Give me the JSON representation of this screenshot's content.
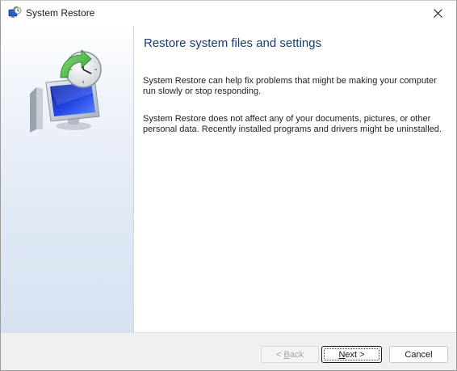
{
  "window": {
    "title": "System Restore",
    "app_icon": "system-restore-icon",
    "close_icon": "close-icon"
  },
  "sidebar": {
    "illustration": "system-restore-monitor-clock-illustration"
  },
  "content": {
    "heading": "Restore system files and settings",
    "paragraph_1": "System Restore can help fix problems that might be making your computer run slowly or stop responding.",
    "paragraph_2": "System Restore does not affect any of your documents, pictures, or other personal data. Recently installed programs and drivers might be uninstalled."
  },
  "buttons": {
    "back": {
      "prefix": "< ",
      "mnemonic": "B",
      "rest": "ack",
      "enabled": false
    },
    "next": {
      "mnemonic": "N",
      "rest": "ext >",
      "enabled": true,
      "default": true
    },
    "cancel": {
      "label": "Cancel",
      "enabled": true
    }
  },
  "colors": {
    "heading": "#1c3b6b",
    "sidebar_gradient_end": "#d7e2f1",
    "footer": "#f0f0f0",
    "disabled_text": "#a3a3a3"
  }
}
